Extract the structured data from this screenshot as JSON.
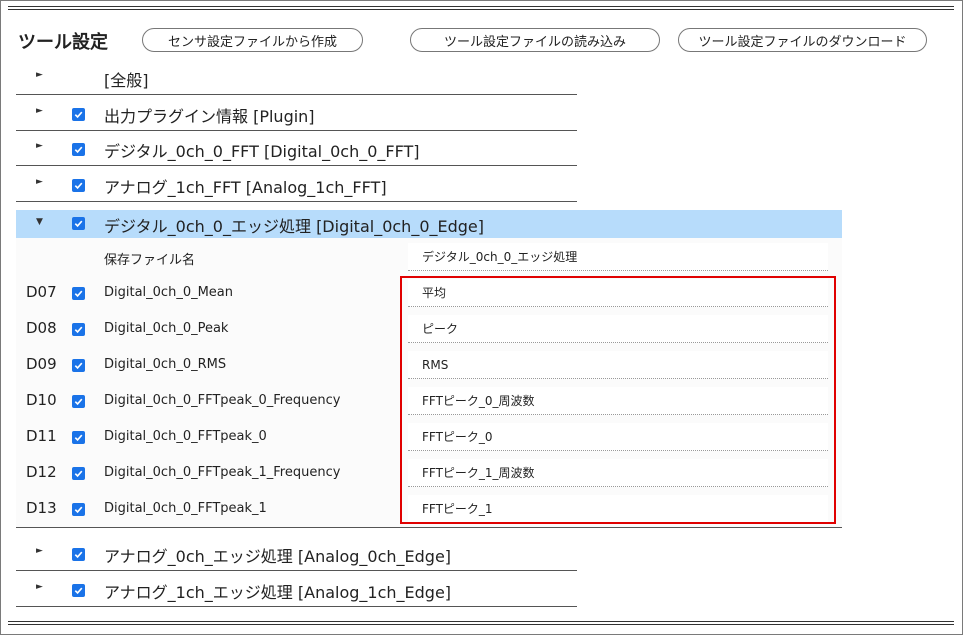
{
  "header": {
    "title": "ツール設定",
    "buttons": [
      "センサ設定ファイルから作成",
      "ツール設定ファイルの読み込み",
      "ツール設定ファイルのダウンロード"
    ]
  },
  "sections_top": [
    {
      "label": "[全般]",
      "checked": false
    },
    {
      "label": "出力プラグイン情報 [Plugin]",
      "checked": true
    },
    {
      "label": "デジタル_0ch_0_FFT [Digital_0ch_0_FFT]",
      "checked": true
    },
    {
      "label": "アナログ_1ch_FFT [Analog_1ch_FFT]",
      "checked": true
    }
  ],
  "open_section": {
    "label": "デジタル_0ch_0_エッジ処理 [Digital_0ch_0_Edge]",
    "checked": true
  },
  "save_file": {
    "label": "保存ファイル名",
    "value": "デジタル_0ch_0_エッジ処理"
  },
  "items": [
    {
      "code": "D07",
      "name": "Digital_0ch_0_Mean",
      "value": "平均"
    },
    {
      "code": "D08",
      "name": "Digital_0ch_0_Peak",
      "value": "ピーク"
    },
    {
      "code": "D09",
      "name": "Digital_0ch_0_RMS",
      "value": "RMS"
    },
    {
      "code": "D10",
      "name": "Digital_0ch_0_FFTpeak_0_Frequency",
      "value": "FFTピーク_0_周波数"
    },
    {
      "code": "D11",
      "name": "Digital_0ch_0_FFTpeak_0",
      "value": "FFTピーク_0"
    },
    {
      "code": "D12",
      "name": "Digital_0ch_0_FFTpeak_1_Frequency",
      "value": "FFTピーク_1_周波数"
    },
    {
      "code": "D13",
      "name": "Digital_0ch_0_FFTpeak_1",
      "value": "FFTピーク_1"
    }
  ],
  "sections_bottom": [
    {
      "label": "アナログ_0ch_エッジ処理 [Analog_0ch_Edge]",
      "checked": true
    },
    {
      "label": "アナログ_1ch_エッジ処理 [Analog_1ch_Edge]",
      "checked": true
    }
  ],
  "colors": {
    "checkbox": "#1a73e8",
    "open_row": "#b7dcfb",
    "highlight": "#e00000"
  }
}
